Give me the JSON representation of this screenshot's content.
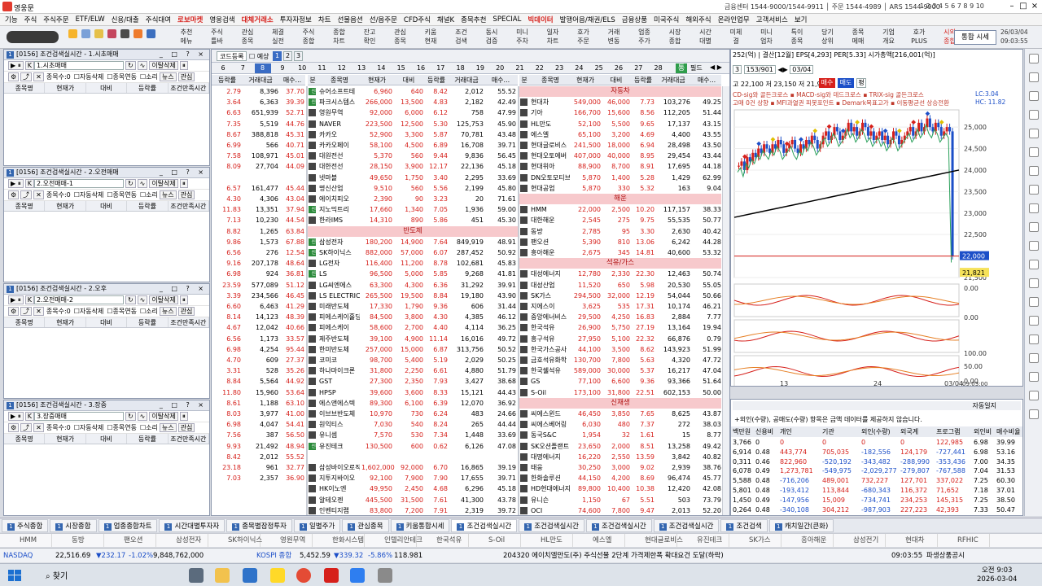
{
  "window": {
    "title": "영웅문",
    "center": "금융센터 1544-9000/1544-9911 │ 주문 1544-4989 │ ARS 1544-9900",
    "rnums": "1 2 3 4 5 6 7 8 9 10"
  },
  "menu": [
    "기능",
    "주식",
    "주식주문",
    "ETF/ELW",
    "신용/대출",
    "주식대여",
    "로보마켓",
    "영웅검색",
    "대체거래소",
    "투자자정보",
    "차트",
    "선물옵션",
    "선/옵주문",
    "CFD주식",
    "채널K",
    "종목추천",
    "SPECIAL",
    "빅데이터",
    "발행어음/채권/ELS",
    "금융상품",
    "미국주식",
    "해외주식",
    "온라인업무",
    "고객서비스",
    "보기"
  ],
  "menu_highlight": [
    "로보마켓",
    "대체거래소",
    "빅데이터"
  ],
  "toolbar": [
    [
      "추천",
      "메뉴"
    ],
    [
      "주식",
      "틀바"
    ],
    [
      "관심",
      "종목"
    ],
    [
      "체결",
      "실전"
    ],
    [
      "주식",
      "종합"
    ],
    [
      "종합",
      "차트"
    ],
    [
      "잔고",
      "확인"
    ],
    [
      "관심",
      "종목"
    ],
    [
      "키움",
      "현재"
    ],
    [
      "조건",
      "검색"
    ],
    [
      "동시",
      "검증"
    ],
    [
      "미니",
      "주차"
    ],
    [
      "일자",
      "차트"
    ],
    [
      "호가",
      "주문"
    ],
    [
      "거래",
      "변동"
    ],
    [
      "업종",
      "주가"
    ],
    [
      "시장",
      "종합"
    ],
    [
      "시간",
      "대별"
    ],
    [
      "미체",
      "결"
    ],
    [
      "미니",
      "업차"
    ],
    [
      "특이",
      "종목"
    ],
    [
      "당기",
      "상위"
    ],
    [
      "종목",
      "메매"
    ],
    [
      "기업",
      "개요"
    ],
    [
      "호가",
      "PLUS"
    ],
    [
      "시외",
      "종합"
    ]
  ],
  "toolbar_right": "통합 시세",
  "toolbar_time": [
    "26/03/04",
    "09:03:55"
  ],
  "panels": [
    {
      "head": "[0156] 조건검색실시간 - 1.시초매매",
      "strategy": "1.시초매매"
    },
    {
      "head": "[0156] 조건검색실시간 - 2.오전매매",
      "strategy": "2.오전매매-1"
    },
    {
      "head": "[0156] 조건검색실시간 - 2.오후",
      "strategy": "2.오전매매-2"
    },
    {
      "head": "[0156] 조건검색실시간 - 3.장중",
      "strategy": "3.장중매매"
    }
  ],
  "panel_labels": {
    "btn1": "이탈삭제",
    "count": "종목수:0",
    "auto": "자동삭제",
    "link": "종목연동",
    "sound": "소리",
    "news": "뉴스",
    "interest": "관심"
  },
  "panel_cols": [
    "종목명",
    "현재가",
    "대비",
    "등락률",
    "조건만족시간"
  ],
  "mid": {
    "tab": "코드등록",
    "check": "예상",
    "pages": [
      "1",
      "2",
      "3"
    ],
    "days": [
      "6",
      "7",
      "8",
      "9",
      "10",
      "11",
      "12",
      "13",
      "14",
      "15",
      "16",
      "17",
      "18",
      "19",
      "20",
      "21",
      "22",
      "23",
      "24",
      "25",
      "26",
      "27",
      "28"
    ],
    "sel_day": "8",
    "right_btns": [
      "통",
      "필드"
    ]
  },
  "cols_a": [
    "등락률",
    "거래대금",
    "매수..."
  ],
  "cols_b": [
    "분",
    "종목명",
    "현재가",
    "대비",
    "등락률",
    "거래대금",
    "매수..."
  ],
  "tblA": [
    [
      "2.79",
      "8,396",
      "37.70"
    ],
    [
      "3.64",
      "6,363",
      "39.39"
    ],
    [
      "6.63",
      "651,939",
      "52.71"
    ],
    [
      "7.35",
      "5,519",
      "44.76"
    ],
    [
      "8.67",
      "388,818",
      "45.31"
    ],
    [
      "6.99",
      "566",
      "40.71"
    ],
    [
      "7.58",
      "108,971",
      "45.01"
    ],
    [
      "8.09",
      "27,704",
      "44.09"
    ],
    [
      "",
      "",
      " "
    ],
    [
      "6.57",
      "161,477",
      "45.44"
    ],
    [
      "4.30",
      "4,306",
      "43.04"
    ],
    [
      "11.83",
      "13,351",
      "37.94"
    ],
    [
      "7.13",
      "10,230",
      "44.54"
    ],
    [
      "8.82",
      "1,265",
      "63.84"
    ],
    [
      "9.86",
      "1,573",
      "67.88"
    ],
    [
      "6.56",
      "276",
      "12.54"
    ],
    [
      "9.16",
      "207,178",
      "48.64"
    ],
    [
      "6.98",
      "924",
      "36.81"
    ],
    [
      "23.59",
      "577,089",
      "51.12"
    ],
    [
      "3.39",
      "234,566",
      "46.45"
    ],
    [
      "6.60",
      "6,463",
      "41.29"
    ],
    [
      "8.14",
      "14,123",
      "48.39"
    ],
    [
      "4.67",
      "12,042",
      "40.66"
    ],
    [
      "6.56",
      "1,173",
      "33.57"
    ],
    [
      "6.98",
      "4,254",
      "95.44"
    ],
    [
      "4.70",
      "609",
      "27.37"
    ],
    [
      "3.31",
      "528",
      "35.26"
    ],
    [
      "8.84",
      "5,564",
      "44.92"
    ],
    [
      "11.80",
      "15,960",
      "53.64"
    ],
    [
      "8.61",
      "1,188",
      "63.10"
    ],
    [
      "8.03",
      "3,977",
      "41.00"
    ],
    [
      "6.98",
      "4,047",
      "54.41"
    ],
    [
      "7.56",
      "387",
      "56.50"
    ],
    [
      "9.93",
      "21,492",
      "48.94"
    ],
    [
      "8.42",
      "2,012",
      "55.52"
    ],
    [
      "23.18",
      "961",
      "32.77"
    ],
    [
      "7.03",
      "2,357",
      "36.90"
    ]
  ],
  "tblB": [
    [
      "신",
      "슈어소프트테",
      "6,960",
      "640",
      "8.42",
      "2,012",
      "55.52"
    ],
    [
      "신",
      "파크시스템스",
      "266,000",
      "13,500",
      "4.83",
      "2,182",
      "42.49"
    ],
    [
      "",
      "영원무역",
      "92,000",
      "6,000",
      "6.12",
      "758",
      "47.99"
    ],
    [
      "",
      "NAVER",
      "223,500",
      "12,500",
      "5.30",
      "125,753",
      "45.90"
    ],
    [
      "",
      "카카오",
      "52,900",
      "3,300",
      "5.87",
      "70,781",
      "43.48"
    ],
    [
      "",
      "카카오페이",
      "58,100",
      "4,500",
      "6.89",
      "16,708",
      "39.71"
    ],
    [
      "",
      "대원전선",
      "5,370",
      "560",
      "9.44",
      "9,836",
      "56.45"
    ],
    [
      "",
      "대한전선",
      "28,150",
      "3,900",
      "12.17",
      "22,136",
      "45.18"
    ],
    [
      "",
      "넷마블",
      "49,650",
      "1,750",
      "3.40",
      "2,295",
      "33.69"
    ],
    [
      "",
      "명신산업",
      "9,510",
      "560",
      "5.56",
      "2,199",
      "45.80"
    ],
    [
      "",
      "에이치피오",
      "2,390",
      "90",
      "3.23",
      "20",
      "71.61"
    ],
    [
      "신",
      "지노믹트리",
      "17,660",
      "1,340",
      "7.05",
      "1,936",
      "59.00"
    ],
    [
      "",
      "한라IMS",
      "14,310",
      "890",
      "5.86",
      "451",
      "45.30"
    ],
    [
      "SECT",
      "반도체"
    ],
    [
      "신",
      "삼성전자",
      "180,200",
      "14,900",
      "7.64",
      "849,919",
      "48.91"
    ],
    [
      "신",
      "SK하이닉스",
      "882,000",
      "57,000",
      "6.07",
      "287,452",
      "50.92"
    ],
    [
      "",
      "LG전자",
      "116,400",
      "11,200",
      "8.78",
      "102,681",
      "45.83"
    ],
    [
      "신",
      "LS",
      "96,500",
      "5,000",
      "5.85",
      "9,268",
      "41.81"
    ],
    [
      "",
      "LG씨엔에스",
      "63,300",
      "4,300",
      "6.36",
      "31,292",
      "39.91"
    ],
    [
      "",
      "LS ELECTRIC",
      "265,500",
      "19,500",
      "8.84",
      "19,180",
      "43.90"
    ],
    [
      "",
      "미래반도체",
      "17,330",
      "1,790",
      "9.36",
      "606",
      "31.44"
    ],
    [
      "",
      "피에스케이홀딩",
      "84,500",
      "3,800",
      "4.30",
      "4,385",
      "46.12"
    ],
    [
      "",
      "피에스케이",
      "58,600",
      "2,700",
      "4.40",
      "4,114",
      "36.25"
    ],
    [
      "",
      "제주반도체",
      "39,100",
      "4,900",
      "11.14",
      "16,016",
      "49.72"
    ],
    [
      "",
      "한미반도체",
      "257,000",
      "15,000",
      "6.87",
      "313,756",
      "50.52"
    ],
    [
      "",
      "코미코",
      "98,700",
      "5,400",
      "5.19",
      "2,029",
      "50.25"
    ],
    [
      "",
      "하나마이크론",
      "31,800",
      "2,250",
      "6.61",
      "4,880",
      "51.79"
    ],
    [
      "",
      "GST",
      "27,300",
      "2,350",
      "7.93",
      "3,427",
      "38.68"
    ],
    [
      "",
      "HPSP",
      "39,600",
      "3,600",
      "8.33",
      "15,121",
      "44.43"
    ],
    [
      "",
      "에스앤에스텍",
      "89,300",
      "6,100",
      "6.39",
      "12,070",
      "36.92"
    ],
    [
      "",
      "이브브반도체",
      "10,970",
      "730",
      "6.24",
      "483",
      "24.66"
    ],
    [
      "",
      "원익티스",
      "7,030",
      "540",
      "8.24",
      "265",
      "44.44"
    ],
    [
      "",
      "유니셈",
      "7,570",
      "530",
      "7.34",
      "1,448",
      "33.69"
    ],
    [
      "신",
      "유진테크",
      "130,500",
      "600",
      "0.62",
      "6,126",
      "47.08"
    ],
    [
      "",
      "",
      " ",
      "",
      "",
      "",
      ""
    ],
    [
      "",
      "삼성바이오로직",
      "1,602,000",
      "92,000",
      "6.70",
      "16,865",
      "39.19"
    ],
    [
      "",
      "지투지바이오",
      "92,100",
      "7,900",
      "7.90",
      "17,655",
      "39.71"
    ],
    [
      "",
      "HK이노엔",
      "49,950",
      "2,450",
      "4.68",
      "6,296",
      "45.18"
    ],
    [
      "",
      "알테오젠",
      "445,500",
      "31,500",
      "7.61",
      "41,300",
      "43.78"
    ],
    [
      "",
      "인벤티지랩",
      "83,800",
      "7,200",
      "7.91",
      "2,319",
      "39.72"
    ],
    [
      "",
      "삼천당제약",
      "719,000",
      "35,000",
      "4.64",
      "125,350",
      "46.53"
    ],
    [
      "",
      "휴젤",
      "10,160",
      "900",
      "8.14",
      "772",
      "25.19"
    ]
  ],
  "tblC": [
    [
      "SECT",
      "자동차"
    ],
    [
      "",
      "현대차",
      "549,000",
      "46,000",
      "7.73",
      "103,276",
      "49.25"
    ],
    [
      "",
      "기아",
      "166,700",
      "15,600",
      "8.56",
      "112,205",
      "51.44"
    ],
    [
      "",
      "HL만도",
      "52,100",
      "5,500",
      "9.65",
      "17,137",
      "43.15"
    ],
    [
      "",
      "에스엘",
      "65,100",
      "3,200",
      "4.69",
      "4,400",
      "43.55"
    ],
    [
      "",
      "현대글로비스",
      "241,500",
      "18,000",
      "6.94",
      "28,498",
      "43.50"
    ],
    [
      "",
      "현대오토에버",
      "407,000",
      "40,000",
      "8.95",
      "29,454",
      "43.44"
    ],
    [
      "",
      "현대위아",
      "88,900",
      "8,700",
      "8.91",
      "17,695",
      "44.18"
    ],
    [
      "",
      "DN오토모티브",
      "5,870",
      "1,400",
      "5.28",
      "1,429",
      "62.99"
    ],
    [
      "",
      "현대공업",
      "5,870",
      "330",
      "5.32",
      "163",
      "9.04"
    ],
    [
      "SECT",
      "해운"
    ],
    [
      "",
      "HMM",
      "22,000",
      "2,500",
      "10.20",
      "117,157",
      "38.33"
    ],
    [
      "",
      "대한해운",
      "2,545",
      "275",
      "9.75",
      "55,535",
      "50.77"
    ],
    [
      "",
      "동방",
      "2,785",
      "95",
      "3.30",
      "2,630",
      "40.42"
    ],
    [
      "",
      "팬오션",
      "5,390",
      "810",
      "13.06",
      "6,242",
      "44.28"
    ],
    [
      "",
      "흥아해운",
      "2,675",
      "345",
      "14.81",
      "40,600",
      "53.32"
    ],
    [
      "SECT",
      "석유/가스"
    ],
    [
      "",
      "대성에너지",
      "12,780",
      "2,330",
      "22.30",
      "12,463",
      "50.74"
    ],
    [
      "",
      "대성산업",
      "11,520",
      "650",
      "5.98",
      "20,530",
      "55.05"
    ],
    [
      "",
      "SK가스",
      "294,500",
      "32,000",
      "12.19",
      "54,044",
      "50.66"
    ],
    [
      "",
      "지에스이",
      "3,625",
      "535",
      "17.31",
      "10,174",
      "46.21"
    ],
    [
      "",
      "중앙에너비스",
      "29,500",
      "4,250",
      "16.83",
      "2,884",
      "7.77"
    ],
    [
      "",
      "한국석유",
      "26,900",
      "5,750",
      "27.19",
      "13,164",
      "19.94"
    ],
    [
      "",
      "흥구석유",
      "27,950",
      "5,100",
      "22.32",
      "66,876",
      "0.79"
    ],
    [
      "",
      "한국가스공사",
      "44,100",
      "3,500",
      "8.62",
      "143,923",
      "51.99"
    ],
    [
      "",
      "금호석유화학",
      "130,700",
      "7,800",
      "5.63",
      "4,320",
      "47.72"
    ],
    [
      "",
      "한국쉘석유",
      "589,000",
      "30,000",
      "5.37",
      "16,217",
      "47.04"
    ],
    [
      "",
      "GS",
      "77,100",
      "6,600",
      "9.36",
      "93,366",
      "51.64"
    ],
    [
      "",
      "S-Oil",
      "173,100",
      "31,800",
      "22.51",
      "602,153",
      "50.00"
    ],
    [
      "SECT",
      "신재생"
    ],
    [
      "",
      "씨에스윈드",
      "46,450",
      "3,850",
      "7.65",
      "8,625",
      "43.87"
    ],
    [
      "",
      "씨에스베어링",
      "6,030",
      "480",
      "7.37",
      "272",
      "38.03"
    ],
    [
      "",
      "동국S&C",
      "1,954",
      "32",
      "1.61",
      "15",
      "8.77"
    ],
    [
      "",
      "SK오션플랜트",
      "23,650",
      "2,000",
      "8.51",
      "13,258",
      "49.42"
    ],
    [
      "",
      "대명에너지",
      "16,220",
      "2,550",
      "13.59",
      "3,842",
      "40.82"
    ],
    [
      "",
      "태웅",
      "30,250",
      "3,000",
      "9.02",
      "2,939",
      "38.76"
    ],
    [
      "",
      "한화솔루션",
      "44,150",
      "4,200",
      "8.69",
      "96,474",
      "45.77"
    ],
    [
      "",
      "HD현대에너지",
      "89,800",
      "10,400",
      "10.38",
      "12,420",
      "42.08"
    ],
    [
      "",
      "유니슨",
      "1,150",
      "67",
      "5.51",
      "503",
      "73.79"
    ],
    [
      "",
      "OCI",
      "74,600",
      "7,800",
      "9.47",
      "2,013",
      "52.20"
    ],
    [
      "",
      "OCI홀딩스",
      "136,900",
      "11,300",
      "7.62",
      "4,406",
      "39.48"
    ],
    [
      "SECT",
      "조선"
    ]
  ],
  "chart": {
    "top_info": "252(억) | 결산[12월] EPS[4,293] PER[5.33] 시가총액[216,001(억)]",
    "code_row": [
      "153/901",
      "03/04"
    ],
    "quote": "고 22,100 저 23,150 저 21,950",
    "btns": [
      "매수",
      "매도",
      "평"
    ],
    "legend": "CD-sig와 골든크로스 ▪ MACD-sig와 데드크로스 ▪ TRIX-sig 골든크로스",
    "legend2": "고매 0건 상향 ▪ MFI과열권 피봇포인트 ▪ Demark목표고가 ▪ 이동평균선 상승전환",
    "lc": "LC:3.04",
    "hc": "HC: 11.82",
    "yticks": [
      "25,000",
      "24,500",
      "24,000",
      "23,500",
      "23,000",
      "22,500",
      "22,000",
      "21,500"
    ],
    "price": "22,000",
    "price2": "21,821",
    "ind_ticks": [
      "0.00",
      "0.00",
      "100.00",
      "50.00",
      "0.00"
    ],
    "xticks": [
      "13",
      "24",
      "03/04"
    ],
    "x_end": "09:03:00",
    "values": [
      24.1,
      24.2,
      24.0,
      24.3,
      24.2,
      24.4,
      24.3,
      24.5,
      24.4,
      24.6,
      24.5,
      24.4,
      24.6,
      24.5,
      24.7,
      24.6,
      24.4,
      24.5,
      24.6,
      24.7,
      24.5,
      24.4,
      24.6,
      24.5,
      24.7,
      24.6,
      24.8,
      24.7,
      24.5,
      24.6,
      24.8,
      24.9,
      24.7,
      24.8,
      25.0,
      24.9,
      24.7,
      24.8,
      24.9,
      25.1,
      24.9,
      25.0,
      24.8,
      24.9,
      25.1,
      25.0,
      24.8,
      24.9,
      24.7,
      24.8,
      24.9,
      24.7,
      24.8,
      24.6,
      24.7,
      24.9,
      24.8,
      24.6,
      24.7,
      24.8,
      24.9,
      25.0,
      24.8,
      24.9,
      25.1,
      24.9,
      25.0,
      25.2,
      25.0,
      24.9,
      25.1,
      25.0,
      24.8,
      24.9,
      25.0,
      24.9,
      22.0
    ],
    "black": [
      22.9,
      23.0,
      23.1,
      23.2,
      23.3,
      23.4,
      23.5,
      23.6,
      23.7,
      23.8,
      23.9,
      24.0
    ],
    "ymin": 21.5,
    "ymax": 25.4
  },
  "flow": {
    "head_right": "자동일지",
    "note": "+외인(수량), 공매도(수량) 항목은 금액 데이터를 제공하지 않습니다.",
    "cols": [
      "백만원",
      "신용비",
      "개인",
      "기관",
      "외인(수량)",
      "외국계",
      "프로그램",
      "외인비",
      "매수비율"
    ],
    "rows": [
      [
        "3,766",
        "0",
        "0",
        "0",
        "0",
        "0",
        "122,985",
        "6.98",
        "39.99"
      ],
      [
        "6,914",
        "0.48",
        "443,774",
        "705,035",
        "-182,556",
        "124,179",
        "-727,441",
        "6.98",
        "53.16"
      ],
      [
        "0,311",
        "0.46",
        "822,960",
        "-520,192",
        "-343,482",
        "-288,990",
        "-353,436",
        "7.00",
        "34.35"
      ],
      [
        "6,078",
        "0.49",
        "1,273,781",
        "-549,975",
        "-2,029,277",
        "-279,807",
        "-767,588",
        "7.04",
        "31.53"
      ],
      [
        "5,588",
        "0.48",
        "-716,206",
        "489,001",
        "732,227",
        "127,701",
        "337,022",
        "7.25",
        "60.30"
      ],
      [
        "5,801",
        "0.48",
        "-193,412",
        "113,844",
        "-680,343",
        "116,372",
        "71,652",
        "7.18",
        "37.01"
      ],
      [
        "1,450",
        "0.49",
        "-147,956",
        "15,009",
        "-734,741",
        "234,253",
        "145,315",
        "7.25",
        "38.50"
      ],
      [
        "0,264",
        "0.48",
        "-340,108",
        "304,212",
        "-987,903",
        "227,223",
        "42,393",
        "7.33",
        "50.47"
      ]
    ]
  },
  "tabs": [
    "주식종합",
    "시장종합",
    "업종종합차트",
    "시간대별투자자",
    "종목별잠정투자",
    "일별주가",
    "관심종목",
    "키움통합시세",
    "조건검색실시간",
    "조건검색실시간",
    "조건검색실시간",
    "조건검색실시간",
    "조건검색",
    "캐치일간(큰화)"
  ],
  "active_tab": 8,
  "watch": [
    "HMM",
    "동방",
    "팬오션",
    "삼성전자",
    "SK하이닉스",
    "영원무역",
    "한화시스템",
    "인텔리안테크",
    "한국석유",
    "S-Oil",
    "HL만도",
    "에스엘",
    "현대글로비스",
    "유진테크",
    "SK가스",
    "흥아해운",
    "삼성전기",
    "현대차",
    "RFHIC"
  ],
  "ticker": {
    "nasdaq": "NASDAQ",
    "nasdaq_v": "22,516.69",
    "nasdaq_c": "▼232.17",
    "nasdaq_p": "-1.02%",
    "nasdaq_vol": "9,848,762,000",
    "kospi": "KOSPI 종합",
    "kospi_v": "5,452.59",
    "kospi_c": "▼339.32",
    "kospi_p": "-5.86%",
    "kospi_x": "118.981",
    "news": "204320 에이치엘만도(주) 주식선물 2단계 가격제한폭 확대요건 도달(하락)",
    "time": "09:03:55",
    "right": "파생상품공시"
  },
  "taskbar": {
    "search": "찾기",
    "time": "오전 9:03",
    "date": "2026-03-04"
  },
  "colors": {
    "up": "#d6201b",
    "down": "#1c4fc8",
    "sect_bg": "#f7c9cc"
  }
}
